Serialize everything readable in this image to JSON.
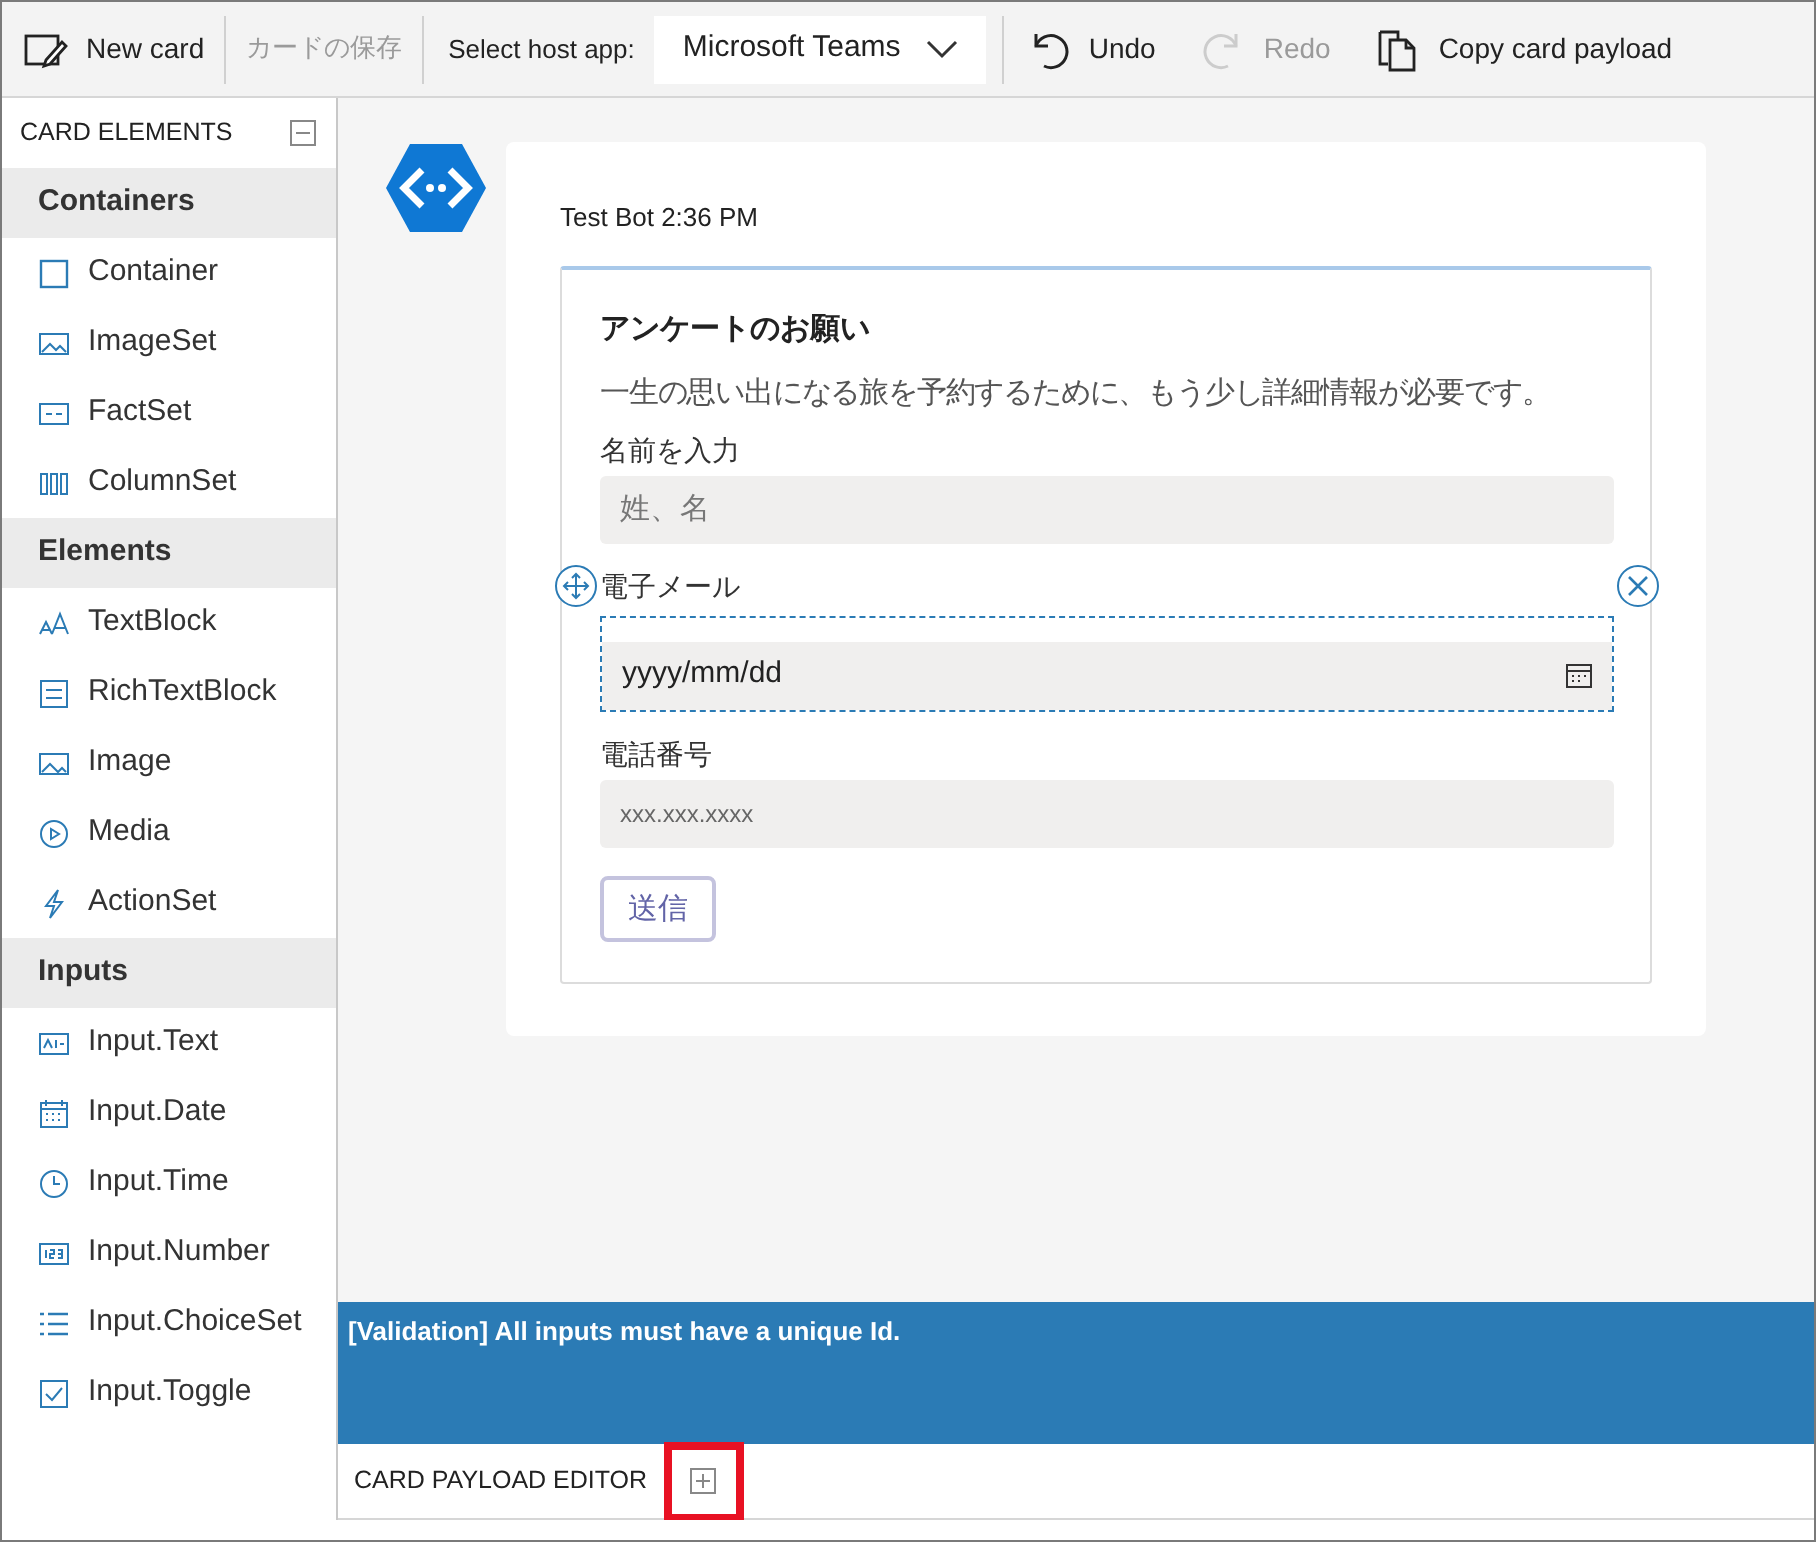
{
  "toolbar": [
    {
      "kind": "new",
      "label": "New card",
      "disabled": false
    },
    {
      "kind": "save",
      "label": "カードの保存",
      "disabled": true
    },
    {
      "kind": "host",
      "label": "Select host app:",
      "value": "Microsoft Teams"
    },
    {
      "kind": "undo",
      "label": "Undo",
      "disabled": false
    },
    {
      "kind": "redo",
      "label": "Redo",
      "disabled": true
    },
    {
      "kind": "copy",
      "label": "Copy card payload",
      "disabled": false
    }
  ],
  "sidebar": {
    "title": "CARD ELEMENTS",
    "expanded": true,
    "groups": [
      {
        "label": "Containers",
        "items": [
          {
            "kind": "container",
            "label": "Container"
          },
          {
            "kind": "imageset",
            "label": "ImageSet"
          },
          {
            "kind": "factset",
            "label": "FactSet"
          },
          {
            "kind": "columnset",
            "label": "ColumnSet"
          }
        ]
      },
      {
        "label": "Elements",
        "items": [
          {
            "kind": "textblock",
            "label": "TextBlock"
          },
          {
            "kind": "richtext",
            "label": "RichTextBlock"
          },
          {
            "kind": "image",
            "label": "Image"
          },
          {
            "kind": "media",
            "label": "Media"
          },
          {
            "kind": "actionset",
            "label": "ActionSet"
          }
        ]
      },
      {
        "label": "Inputs",
        "items": [
          {
            "kind": "inputtext",
            "label": "Input.Text"
          },
          {
            "kind": "inputdate",
            "label": "Input.Date"
          },
          {
            "kind": "inputtime",
            "label": "Input.Time"
          },
          {
            "kind": "inputnumber",
            "label": "Input.Number"
          },
          {
            "kind": "choiceset",
            "label": "Input.ChoiceSet"
          },
          {
            "kind": "toggle",
            "label": "Input.Toggle"
          }
        ]
      }
    ]
  },
  "message": {
    "sender": "Test Bot 2:36 PM",
    "card": {
      "title": "アンケートのお願い",
      "text": "一生の思い出になる旅を予約するために、もう少し詳細情報が必要です。",
      "inputs": [
        {
          "kind": "text",
          "label": "名前を入力",
          "placeholder": "姓、名",
          "selected": false
        },
        {
          "kind": "date",
          "label": "電子メール",
          "placeholder": "yyyy/mm/dd",
          "selected": true
        },
        {
          "kind": "tel",
          "label": "電話番号",
          "placeholder": "xxx.xxx.xxxx",
          "selected": false
        }
      ],
      "action": "送信"
    }
  },
  "validation": "[Validation] All inputs must have a unique Id.",
  "payload_editor": {
    "title": "CARD PAYLOAD EDITOR",
    "expanded": false,
    "highlighted": true
  }
}
